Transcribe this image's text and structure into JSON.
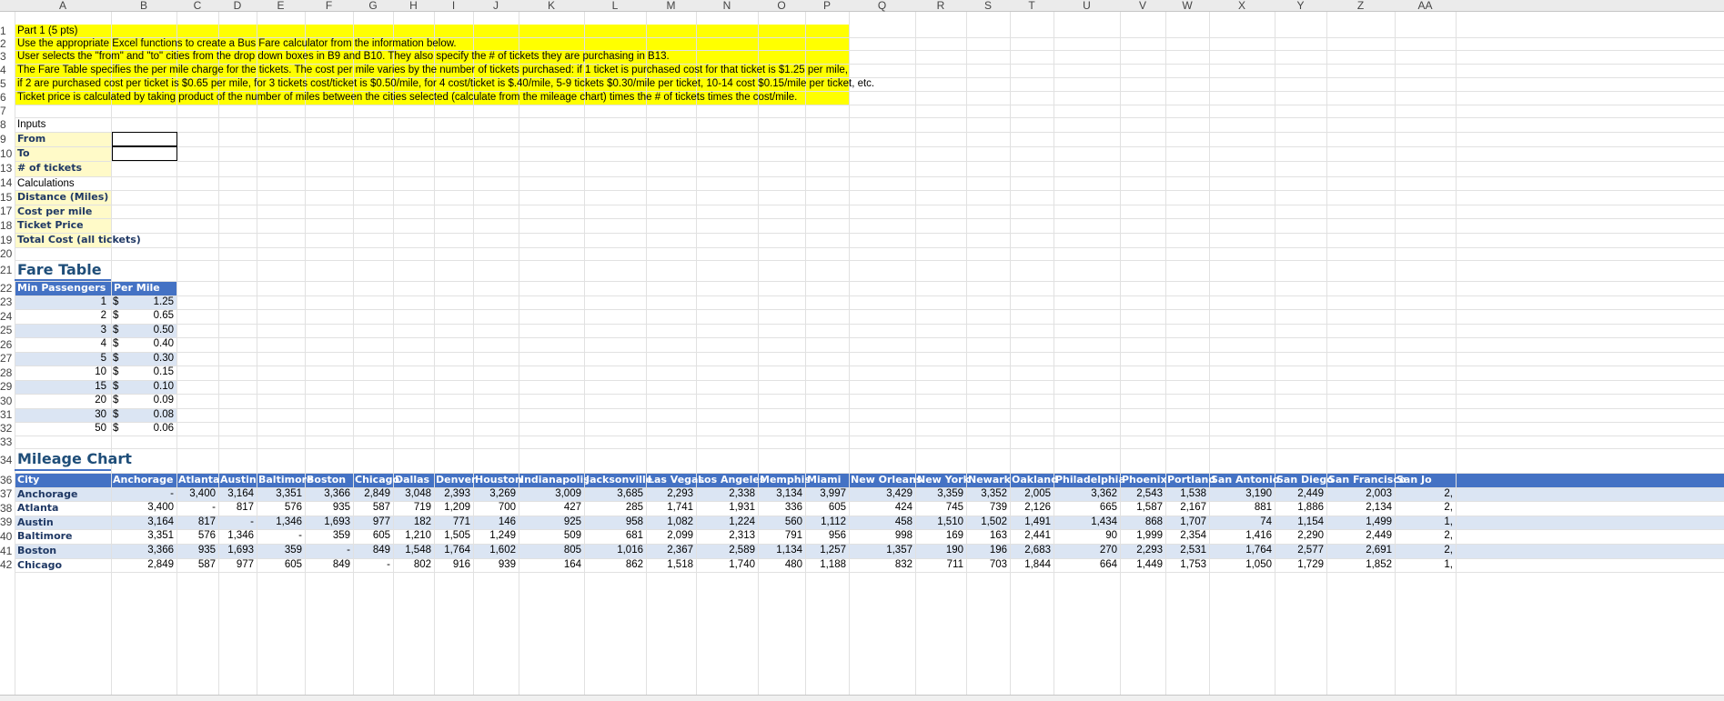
{
  "columns": [
    "A",
    "B",
    "C",
    "D",
    "E",
    "F",
    "G",
    "H",
    "I",
    "J",
    "K",
    "L",
    "M",
    "N",
    "O",
    "P",
    "Q",
    "R",
    "S",
    "T",
    "U",
    "V",
    "W",
    "X",
    "Y",
    "Z",
    "AA"
  ],
  "rows": [
    1,
    2,
    3,
    4,
    5,
    6,
    7,
    8,
    9,
    10,
    13,
    14,
    15,
    17,
    18,
    19,
    20,
    21,
    22,
    23,
    24,
    25,
    26,
    27,
    28,
    29,
    30,
    31,
    32,
    33,
    34,
    36,
    37,
    38,
    39,
    40,
    41,
    42
  ],
  "instructions": [
    "Part 1 (5 pts)",
    "Use the appropriate Excel functions to create a Bus Fare calculator from the information below.",
    "User selects the \"from\" and \"to\" cities from the drop down boxes in B9 and B10.  They also specify the # of tickets they are purchasing in B13.",
    "The Fare Table specifies the per mile charge for the tickets.  The cost per mile varies by the number of tickets purchased:  if 1 ticket is purchased cost for that ticket is $1.25 per mile,",
    " if 2 are purchased cost per ticket is  $0.65 per mile, for 3 tickets cost/ticket is $0.50/mile,  for 4 cost/ticket is $.40/mile, 5-9 tickets $0.30/mile per ticket, 10-14 cost $0.15/mile per ticket, etc.",
    "Ticket price is calculated by taking product of the number of miles between the cities selected (calculate from the mileage chart) times the # of tickets times the cost/mile."
  ],
  "inputs_title": "Inputs",
  "input_labels": [
    "From",
    "To",
    "# of tickets"
  ],
  "calculations_title": "Calculations",
  "calc_labels": [
    "Distance (Miles)",
    "Cost per mile",
    "Ticket Price",
    "Total Cost (all tickets)"
  ],
  "fare_table": {
    "title": "Fare Table",
    "headers": [
      "Min Passengers",
      "Per Mile"
    ],
    "rows": [
      [
        "1",
        "$",
        "1.25"
      ],
      [
        "2",
        "$",
        "0.65"
      ],
      [
        "3",
        "$",
        "0.50"
      ],
      [
        "4",
        "$",
        "0.40"
      ],
      [
        "5",
        "$",
        "0.30"
      ],
      [
        "10",
        "$",
        "0.15"
      ],
      [
        "15",
        "$",
        "0.10"
      ],
      [
        "20",
        "$",
        "0.09"
      ],
      [
        "30",
        "$",
        "0.08"
      ],
      [
        "50",
        "$",
        "0.06"
      ]
    ]
  },
  "mileage_chart": {
    "title": "Mileage Chart",
    "headers": [
      "City",
      "Anchorage",
      "Atlanta",
      "Austin",
      "Baltimore",
      "Boston",
      "Chicago",
      "Dallas",
      "Denver",
      "Houston",
      "Indianapolis",
      "Jacksonville",
      "Las Vegas",
      "Los Angeles",
      "Memphis",
      "Miami",
      "New Orleans",
      "New York",
      "Newark",
      "Oakland",
      "Philadelphia",
      "Phoenix",
      "Portland",
      "San Antonio",
      "San Diego",
      "San Francisco",
      "San Jo"
    ],
    "rows": [
      [
        "Anchorage",
        "-",
        "3,400",
        "3,164",
        "3,351",
        "3,366",
        "2,849",
        "3,048",
        "2,393",
        "3,269",
        "3,009",
        "3,685",
        "2,293",
        "2,338",
        "3,134",
        "3,997",
        "3,429",
        "3,359",
        "3,352",
        "2,005",
        "3,362",
        "2,543",
        "1,538",
        "3,190",
        "2,449",
        "2,003",
        "2,"
      ],
      [
        "Atlanta",
        "3,400",
        "-",
        "817",
        "576",
        "935",
        "587",
        "719",
        "1,209",
        "700",
        "427",
        "285",
        "1,741",
        "1,931",
        "336",
        "605",
        "424",
        "745",
        "739",
        "2,126",
        "665",
        "1,587",
        "2,167",
        "881",
        "1,886",
        "2,134",
        "2,"
      ],
      [
        "Austin",
        "3,164",
        "817",
        "-",
        "1,346",
        "1,693",
        "977",
        "182",
        "771",
        "146",
        "925",
        "958",
        "1,082",
        "1,224",
        "560",
        "1,112",
        "458",
        "1,510",
        "1,502",
        "1,491",
        "1,434",
        "868",
        "1,707",
        "74",
        "1,154",
        "1,499",
        "1,"
      ],
      [
        "Baltimore",
        "3,351",
        "576",
        "1,346",
        "-",
        "359",
        "605",
        "1,210",
        "1,505",
        "1,249",
        "509",
        "681",
        "2,099",
        "2,313",
        "791",
        "956",
        "998",
        "169",
        "163",
        "2,441",
        "90",
        "1,999",
        "2,354",
        "1,416",
        "2,290",
        "2,449",
        "2,"
      ],
      [
        "Boston",
        "3,366",
        "935",
        "1,693",
        "359",
        "-",
        "849",
        "1,548",
        "1,764",
        "1,602",
        "805",
        "1,016",
        "2,367",
        "2,589",
        "1,134",
        "1,257",
        "1,357",
        "190",
        "196",
        "2,683",
        "270",
        "2,293",
        "2,531",
        "1,764",
        "2,577",
        "2,691",
        "2,"
      ],
      [
        "Chicago",
        "2,849",
        "587",
        "977",
        "605",
        "849",
        "-",
        "802",
        "916",
        "939",
        "164",
        "862",
        "1,518",
        "1,740",
        "480",
        "1,188",
        "832",
        "711",
        "703",
        "1,844",
        "664",
        "1,449",
        "1,753",
        "1,050",
        "1,729",
        "1,852",
        "1,"
      ]
    ]
  },
  "colors": {
    "instruction_fill": "#ffff00",
    "input_fill": "#fffac8",
    "header_blue": "#4472c4",
    "band_blue": "#dbe5f3",
    "title_blue": "#1f4e79"
  }
}
